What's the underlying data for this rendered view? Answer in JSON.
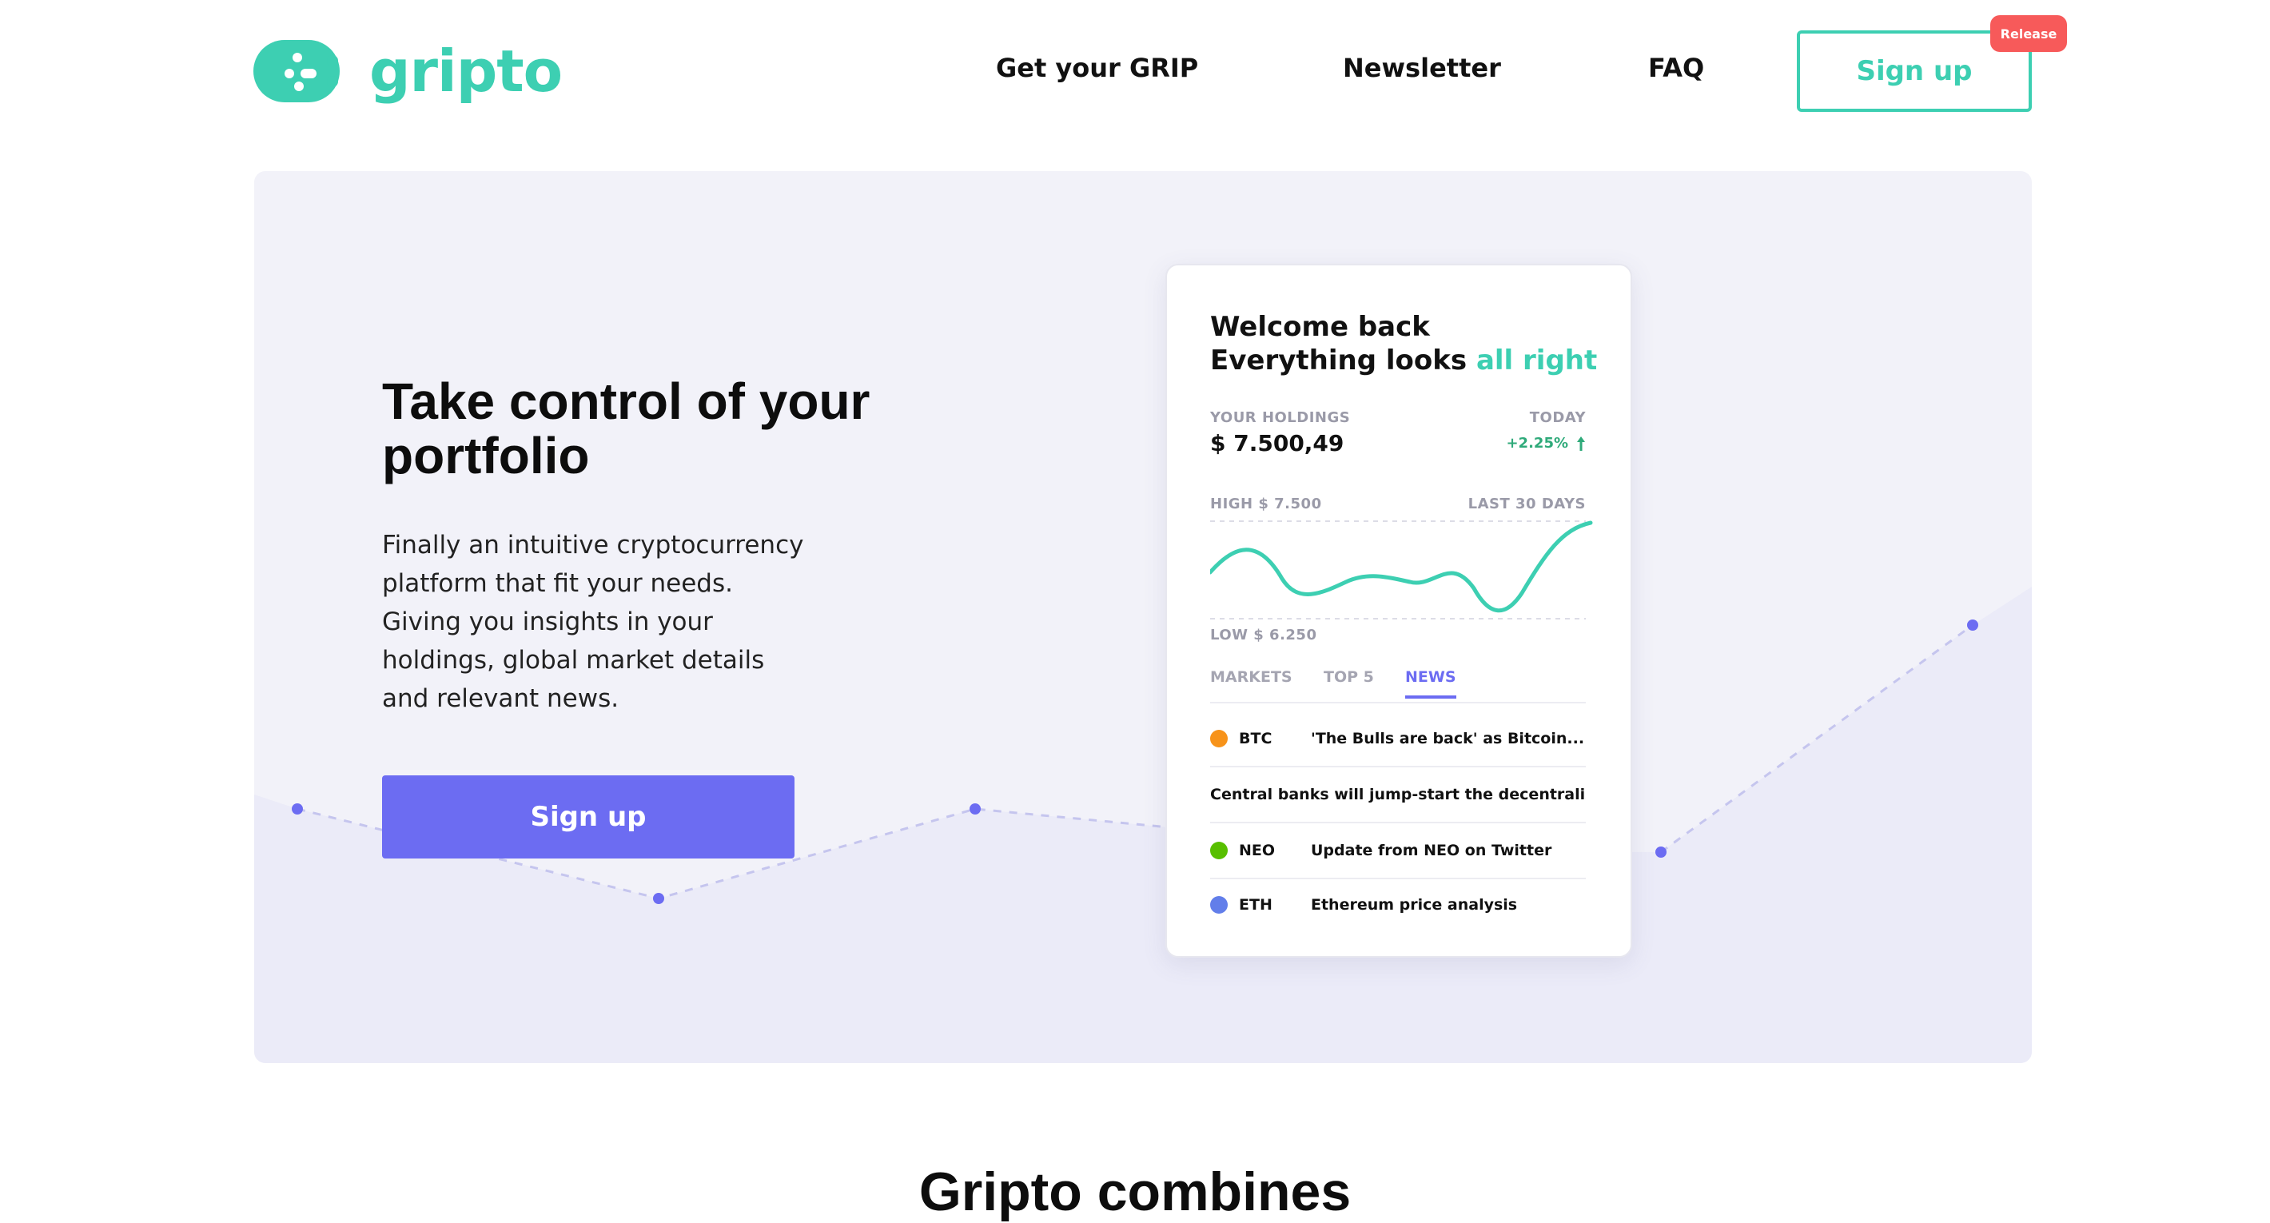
{
  "brand": {
    "name": "gripto",
    "accent_color": "#3dcfb2",
    "icon": "gripto-logo-icon"
  },
  "nav": {
    "links": [
      "Get your GRIP",
      "Newsletter",
      "FAQ"
    ],
    "signup_label": "Sign up",
    "badge": "Release",
    "badge_color": "#f75a5a"
  },
  "hero": {
    "title": "Take control of your portfolio",
    "description": "Finally an intuitive cryptocurrency platform that fit your needs. Giving you insights in your holdings, global market details and relevant news.",
    "cta_label": "Sign up",
    "cta_color": "#6c6cf2"
  },
  "dashboard": {
    "welcome_line1": "Welcome back",
    "welcome_line2_prefix": "Everything looks",
    "welcome_line2_accent": "all right",
    "holdings_label": "YOUR HOLDINGS",
    "holdings_value": "$ 7.500,49",
    "today_label": "TODAY",
    "today_change": "+2.25%",
    "high_label": "HIGH $ 7.500",
    "period_label": "LAST 30 DAYS",
    "low_label": "LOW $ 6.250",
    "tabs": [
      {
        "label": "MARKETS",
        "active": false
      },
      {
        "label": "TOP 5",
        "active": false
      },
      {
        "label": "NEWS",
        "active": true
      }
    ],
    "news": [
      {
        "ticker": "BTC",
        "headline": "'The Bulls are back' as Bitcoin...",
        "icon": "bitcoin-icon",
        "color": "#f7931a"
      },
      {
        "ticker": "",
        "headline": "Central banks will jump-start the decentraliza...",
        "icon": "",
        "color": ""
      },
      {
        "ticker": "NEO",
        "headline": "Update from NEO on Twitter",
        "icon": "neo-icon",
        "color": "#58bf00"
      },
      {
        "ticker": "ETH",
        "headline": "Ethereum price analysis",
        "icon": "ethereum-icon",
        "color": "#627eea"
      }
    ]
  },
  "section": {
    "title": "Gripto combines"
  }
}
